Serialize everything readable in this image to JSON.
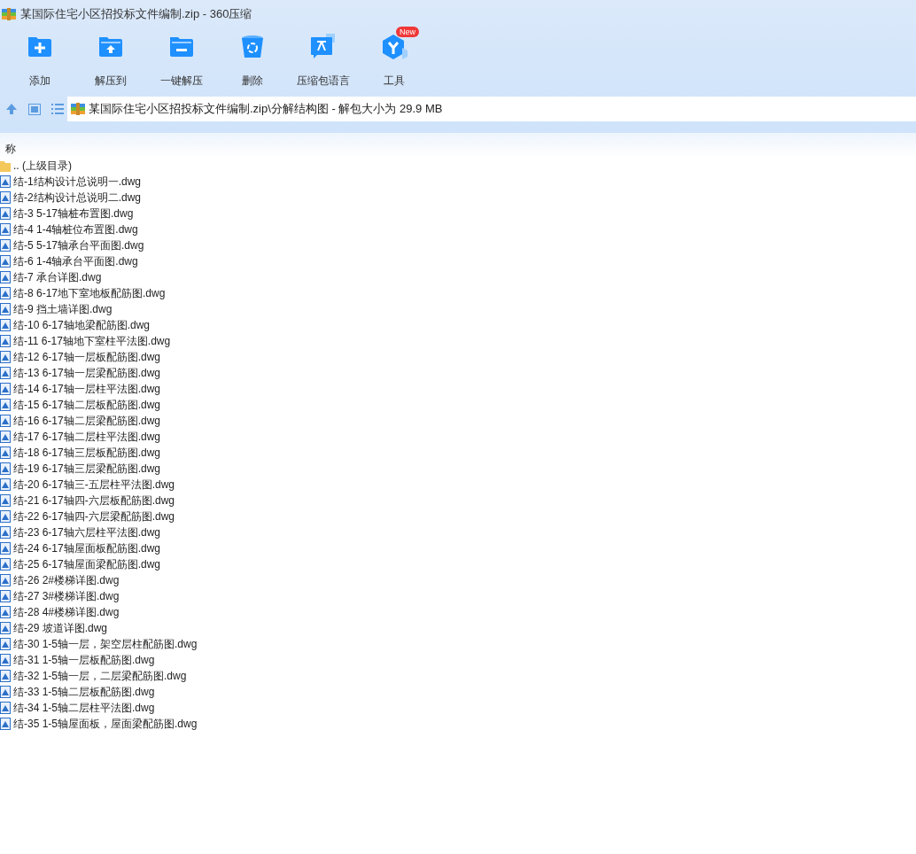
{
  "window": {
    "title": "某国际住宅小区招投标文件编制.zip - 360压缩"
  },
  "toolbar": [
    {
      "kind": "add",
      "label": "添加"
    },
    {
      "kind": "extract",
      "label": "解压到"
    },
    {
      "kind": "oneclick",
      "label": "一键解压"
    },
    {
      "kind": "delete",
      "label": "删除"
    },
    {
      "kind": "language",
      "label": "压缩包语言"
    },
    {
      "kind": "tools",
      "label": "工具",
      "badge": "New"
    }
  ],
  "address": {
    "path": "某国际住宅小区招投标文件编制.zip\\分解结构图 - 解包大小为 29.9 MB"
  },
  "file_list": {
    "columns": [
      "称"
    ],
    "items": [
      {
        "kind": "folder",
        "name": ".. (上级目录)"
      },
      {
        "kind": "file",
        "name": "结-1结构设计总说明一.dwg"
      },
      {
        "kind": "file",
        "name": "结-2结构设计总说明二.dwg"
      },
      {
        "kind": "file",
        "name": "结-3 5-17轴桩布置图.dwg"
      },
      {
        "kind": "file",
        "name": "结-4 1-4轴桩位布置图.dwg"
      },
      {
        "kind": "file",
        "name": "结-5 5-17轴承台平面图.dwg"
      },
      {
        "kind": "file",
        "name": "结-6 1-4轴承台平面图.dwg"
      },
      {
        "kind": "file",
        "name": "结-7 承台详图.dwg"
      },
      {
        "kind": "file",
        "name": "结-8 6-17地下室地板配筋图.dwg"
      },
      {
        "kind": "file",
        "name": "结-9 挡土墙详图.dwg"
      },
      {
        "kind": "file",
        "name": "结-10 6-17轴地梁配筋图.dwg"
      },
      {
        "kind": "file",
        "name": "结-11 6-17轴地下室柱平法图.dwg"
      },
      {
        "kind": "file",
        "name": "结-12 6-17轴一层板配筋图.dwg"
      },
      {
        "kind": "file",
        "name": "结-13 6-17轴一层梁配筋图.dwg"
      },
      {
        "kind": "file",
        "name": "结-14 6-17轴一层柱平法图.dwg"
      },
      {
        "kind": "file",
        "name": "结-15 6-17轴二层板配筋图.dwg"
      },
      {
        "kind": "file",
        "name": "结-16 6-17轴二层梁配筋图.dwg"
      },
      {
        "kind": "file",
        "name": "结-17 6-17轴二层柱平法图.dwg"
      },
      {
        "kind": "file",
        "name": "结-18 6-17轴三层板配筋图.dwg"
      },
      {
        "kind": "file",
        "name": "结-19 6-17轴三层梁配筋图.dwg"
      },
      {
        "kind": "file",
        "name": "结-20 6-17轴三-五层柱平法图.dwg"
      },
      {
        "kind": "file",
        "name": "结-21 6-17轴四-六层板配筋图.dwg"
      },
      {
        "kind": "file",
        "name": "结-22 6-17轴四-六层梁配筋图.dwg"
      },
      {
        "kind": "file",
        "name": "结-23 6-17轴六层柱平法图.dwg"
      },
      {
        "kind": "file",
        "name": "结-24 6-17轴屋面板配筋图.dwg"
      },
      {
        "kind": "file",
        "name": "结-25 6-17轴屋面梁配筋图.dwg"
      },
      {
        "kind": "file",
        "name": "结-26 2#楼梯详图.dwg"
      },
      {
        "kind": "file",
        "name": "结-27 3#楼梯详图.dwg"
      },
      {
        "kind": "file",
        "name": "结-28 4#楼梯详图.dwg"
      },
      {
        "kind": "file",
        "name": "结-29 坡道详图.dwg"
      },
      {
        "kind": "file",
        "name": "结-30 1-5轴一层，架空层柱配筋图.dwg"
      },
      {
        "kind": "file",
        "name": "结-31 1-5轴一层板配筋图.dwg"
      },
      {
        "kind": "file",
        "name": "结-32 1-5轴一层，二层梁配筋图.dwg"
      },
      {
        "kind": "file",
        "name": "结-33 1-5轴二层板配筋图.dwg"
      },
      {
        "kind": "file",
        "name": "结-34 1-5轴二层柱平法图.dwg"
      },
      {
        "kind": "file",
        "name": "结-35 1-5轴屋面板，屋面梁配筋图.dwg"
      }
    ]
  }
}
